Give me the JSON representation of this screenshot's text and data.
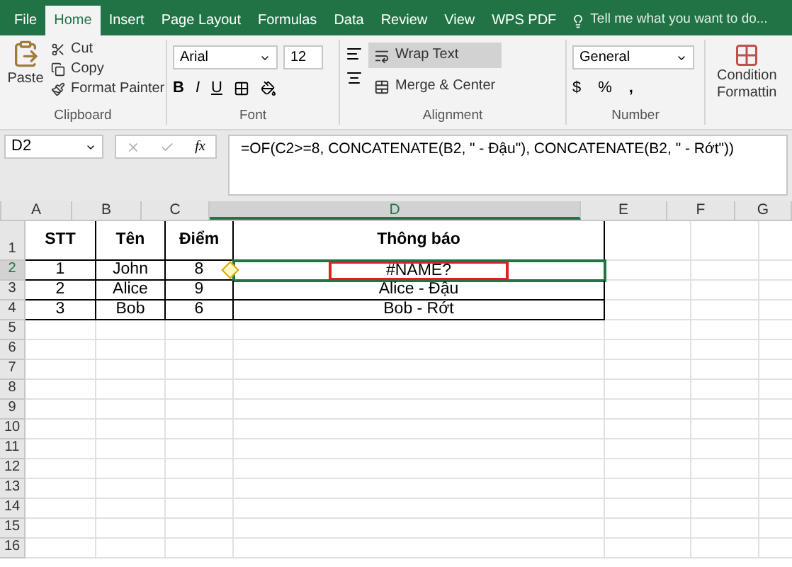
{
  "tabs": [
    {
      "label": "File",
      "selected": false
    },
    {
      "label": "Home",
      "selected": true
    },
    {
      "label": "Insert",
      "selected": false
    },
    {
      "label": "Page Layout",
      "selected": false
    },
    {
      "label": "Formulas",
      "selected": false
    },
    {
      "label": "Data",
      "selected": false
    },
    {
      "label": "Review",
      "selected": false
    },
    {
      "label": "View",
      "selected": false
    },
    {
      "label": "WPS PDF",
      "selected": false
    }
  ],
  "tell_me": "Tell me what you want to do...",
  "clipboard": {
    "paste": "Paste",
    "cut": "Cut",
    "copy": "Copy",
    "format_painter": "Format Painter",
    "label": "Clipboard"
  },
  "font": {
    "name": "Arial",
    "size": "12",
    "bold": "B",
    "italic": "I",
    "underline": "U",
    "label": "Font"
  },
  "alignment": {
    "wrap_text": {
      "label": "Wrap Text",
      "on": true
    },
    "merge": "Merge & Center",
    "label": "Alignment"
  },
  "number": {
    "format": "General",
    "currency": "$",
    "percent": "%",
    "comma": ",",
    "label": "Number"
  },
  "conditional": [
    "Condition",
    "Formattin"
  ],
  "formula_bar": {
    "name_box": "D2",
    "function_label": "fx",
    "formula": "=OF(C2>=8, CONCATENATE(B2, \" - Đậu\"), CONCATENATE(B2, \" - Rớt\"))"
  },
  "columns": [
    {
      "label": "A",
      "selected": false
    },
    {
      "label": "B",
      "selected": false
    },
    {
      "label": "C",
      "selected": false
    },
    {
      "label": "D",
      "selected": true
    },
    {
      "label": "E",
      "selected": false
    },
    {
      "label": "F",
      "selected": false
    },
    {
      "label": "G",
      "selected": false
    }
  ],
  "rows": [
    {
      "number": "1",
      "selected": false,
      "cells": [
        {
          "text": "STT"
        },
        {
          "text": "Tên"
        },
        {
          "text": "Điểm"
        },
        {
          "text": "Thông báo"
        }
      ]
    },
    {
      "number": "2",
      "selected": true,
      "cells": [
        {
          "text": "1"
        },
        {
          "text": "John"
        },
        {
          "text": "8",
          "warning": true
        },
        {
          "text": "#NAME?",
          "flagged": true
        }
      ]
    },
    {
      "number": "3",
      "selected": false,
      "cells": [
        {
          "text": "2"
        },
        {
          "text": "Alice"
        },
        {
          "text": "9"
        },
        {
          "text": "Alice - Đậu"
        }
      ]
    },
    {
      "number": "4",
      "selected": false,
      "cells": [
        {
          "text": "3"
        },
        {
          "text": "Bob"
        },
        {
          "text": "6"
        },
        {
          "text": "Bob - Rớt"
        }
      ]
    },
    {
      "number": "5",
      "selected": false,
      "cells": []
    },
    {
      "number": "6",
      "selected": false,
      "cells": []
    },
    {
      "number": "7",
      "selected": false,
      "cells": []
    },
    {
      "number": "8",
      "selected": false,
      "cells": []
    },
    {
      "number": "9",
      "selected": false,
      "cells": []
    },
    {
      "number": "10",
      "selected": false,
      "cells": []
    },
    {
      "number": "11",
      "selected": false,
      "cells": []
    },
    {
      "number": "12",
      "selected": false,
      "cells": []
    },
    {
      "number": "13",
      "selected": false,
      "cells": []
    },
    {
      "number": "14",
      "selected": false,
      "cells": []
    },
    {
      "number": "15",
      "selected": false,
      "cells": []
    },
    {
      "number": "16",
      "selected": false,
      "cells": []
    }
  ]
}
